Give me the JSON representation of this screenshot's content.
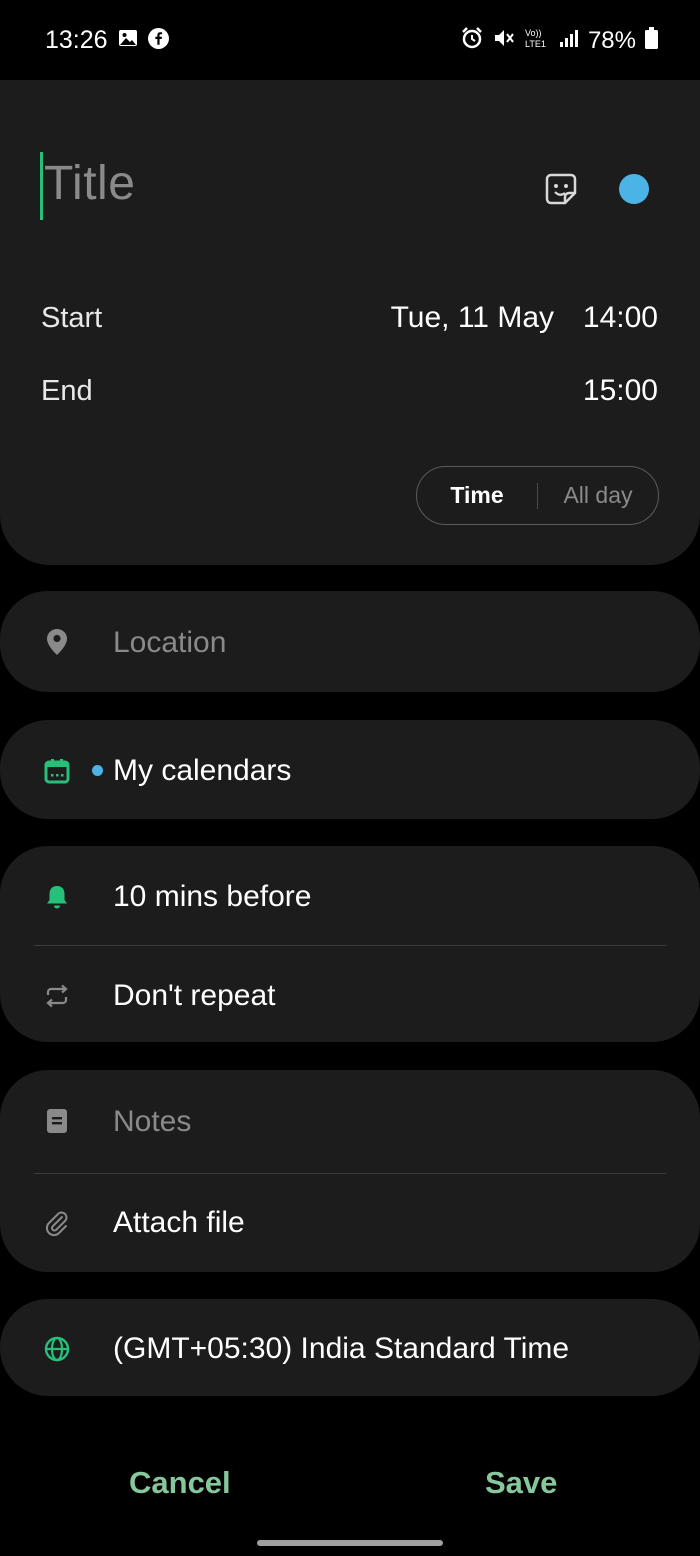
{
  "status_bar": {
    "time": "13:26",
    "battery": "78%",
    "left_icons": [
      "gallery-icon",
      "facebook-icon"
    ],
    "right_icons": [
      "alarm-icon",
      "mute-icon",
      "volte-icon",
      "signal-icon",
      "battery-icon"
    ]
  },
  "event": {
    "title_placeholder": "Title",
    "color": "#4cb3e6",
    "start_label": "Start",
    "start_date": "Tue, 11 May",
    "start_time": "14:00",
    "end_label": "End",
    "end_time": "15:00",
    "mode_toggle": {
      "time_label": "Time",
      "allday_label": "All day",
      "selected": "Time"
    }
  },
  "fields": {
    "location_placeholder": "Location",
    "calendar": "My calendars",
    "reminder": "10 mins before",
    "repeat": "Don't repeat",
    "notes_placeholder": "Notes",
    "attach": "Attach file",
    "timezone": "(GMT+05:30) India Standard Time"
  },
  "actions": {
    "cancel": "Cancel",
    "save": "Save"
  },
  "colors": {
    "accent_green": "#27c07a",
    "button_green": "#86c79c",
    "calendar_blue": "#4cb3e6",
    "card_bg": "#1c1c1c"
  }
}
